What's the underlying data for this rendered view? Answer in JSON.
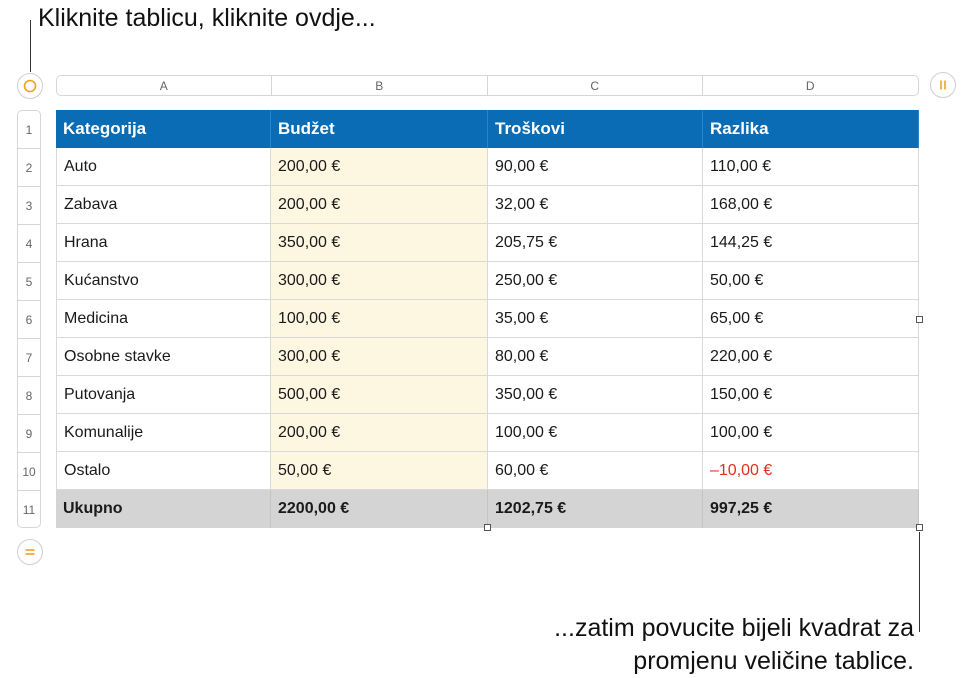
{
  "callouts": {
    "top": "Kliknite tablicu, kliknite ovdje...",
    "bottom_line1": "...zatim povucite bijeli kvadrat za",
    "bottom_line2": "promjenu veličine tablice."
  },
  "column_headers": [
    "A",
    "B",
    "C",
    "D"
  ],
  "row_numbers": [
    "1",
    "2",
    "3",
    "4",
    "5",
    "6",
    "7",
    "8",
    "9",
    "10",
    "11"
  ],
  "table": {
    "header": [
      "Kategorija",
      "Budžet",
      "Troškovi",
      "Razlika"
    ],
    "rows": [
      [
        "Auto",
        "200,00 €",
        "90,00 €",
        "110,00 €"
      ],
      [
        "Zabava",
        "200,00 €",
        "32,00 €",
        "168,00 €"
      ],
      [
        "Hrana",
        "350,00 €",
        "205,75 €",
        "144,25 €"
      ],
      [
        "Kućanstvo",
        "300,00 €",
        "250,00 €",
        "50,00 €"
      ],
      [
        "Medicina",
        "100,00 €",
        "35,00 €",
        "65,00 €"
      ],
      [
        "Osobne stavke",
        "300,00 €",
        "80,00 €",
        "220,00 €"
      ],
      [
        "Putovanja",
        "500,00 €",
        "350,00 €",
        "150,00 €"
      ],
      [
        "Komunalije",
        "200,00 €",
        "100,00 €",
        "100,00 €"
      ],
      [
        "Ostalo",
        "50,00 €",
        "60,00 €",
        "–10,00 €"
      ]
    ],
    "total": [
      "Ukupno",
      "2200,00 €",
      "1202,75 €",
      "997,25 €"
    ]
  },
  "colors": {
    "accent": "#f0a020",
    "header_blue": "#0a6cb4",
    "budget_highlight": "#fdf6e1",
    "negative": "#e0301e",
    "total_row": "#d4d4d4"
  },
  "icons": {
    "select_table": "circle-select-icon",
    "add_column": "column-pause-icon",
    "add_row": "equals-rows-icon"
  }
}
